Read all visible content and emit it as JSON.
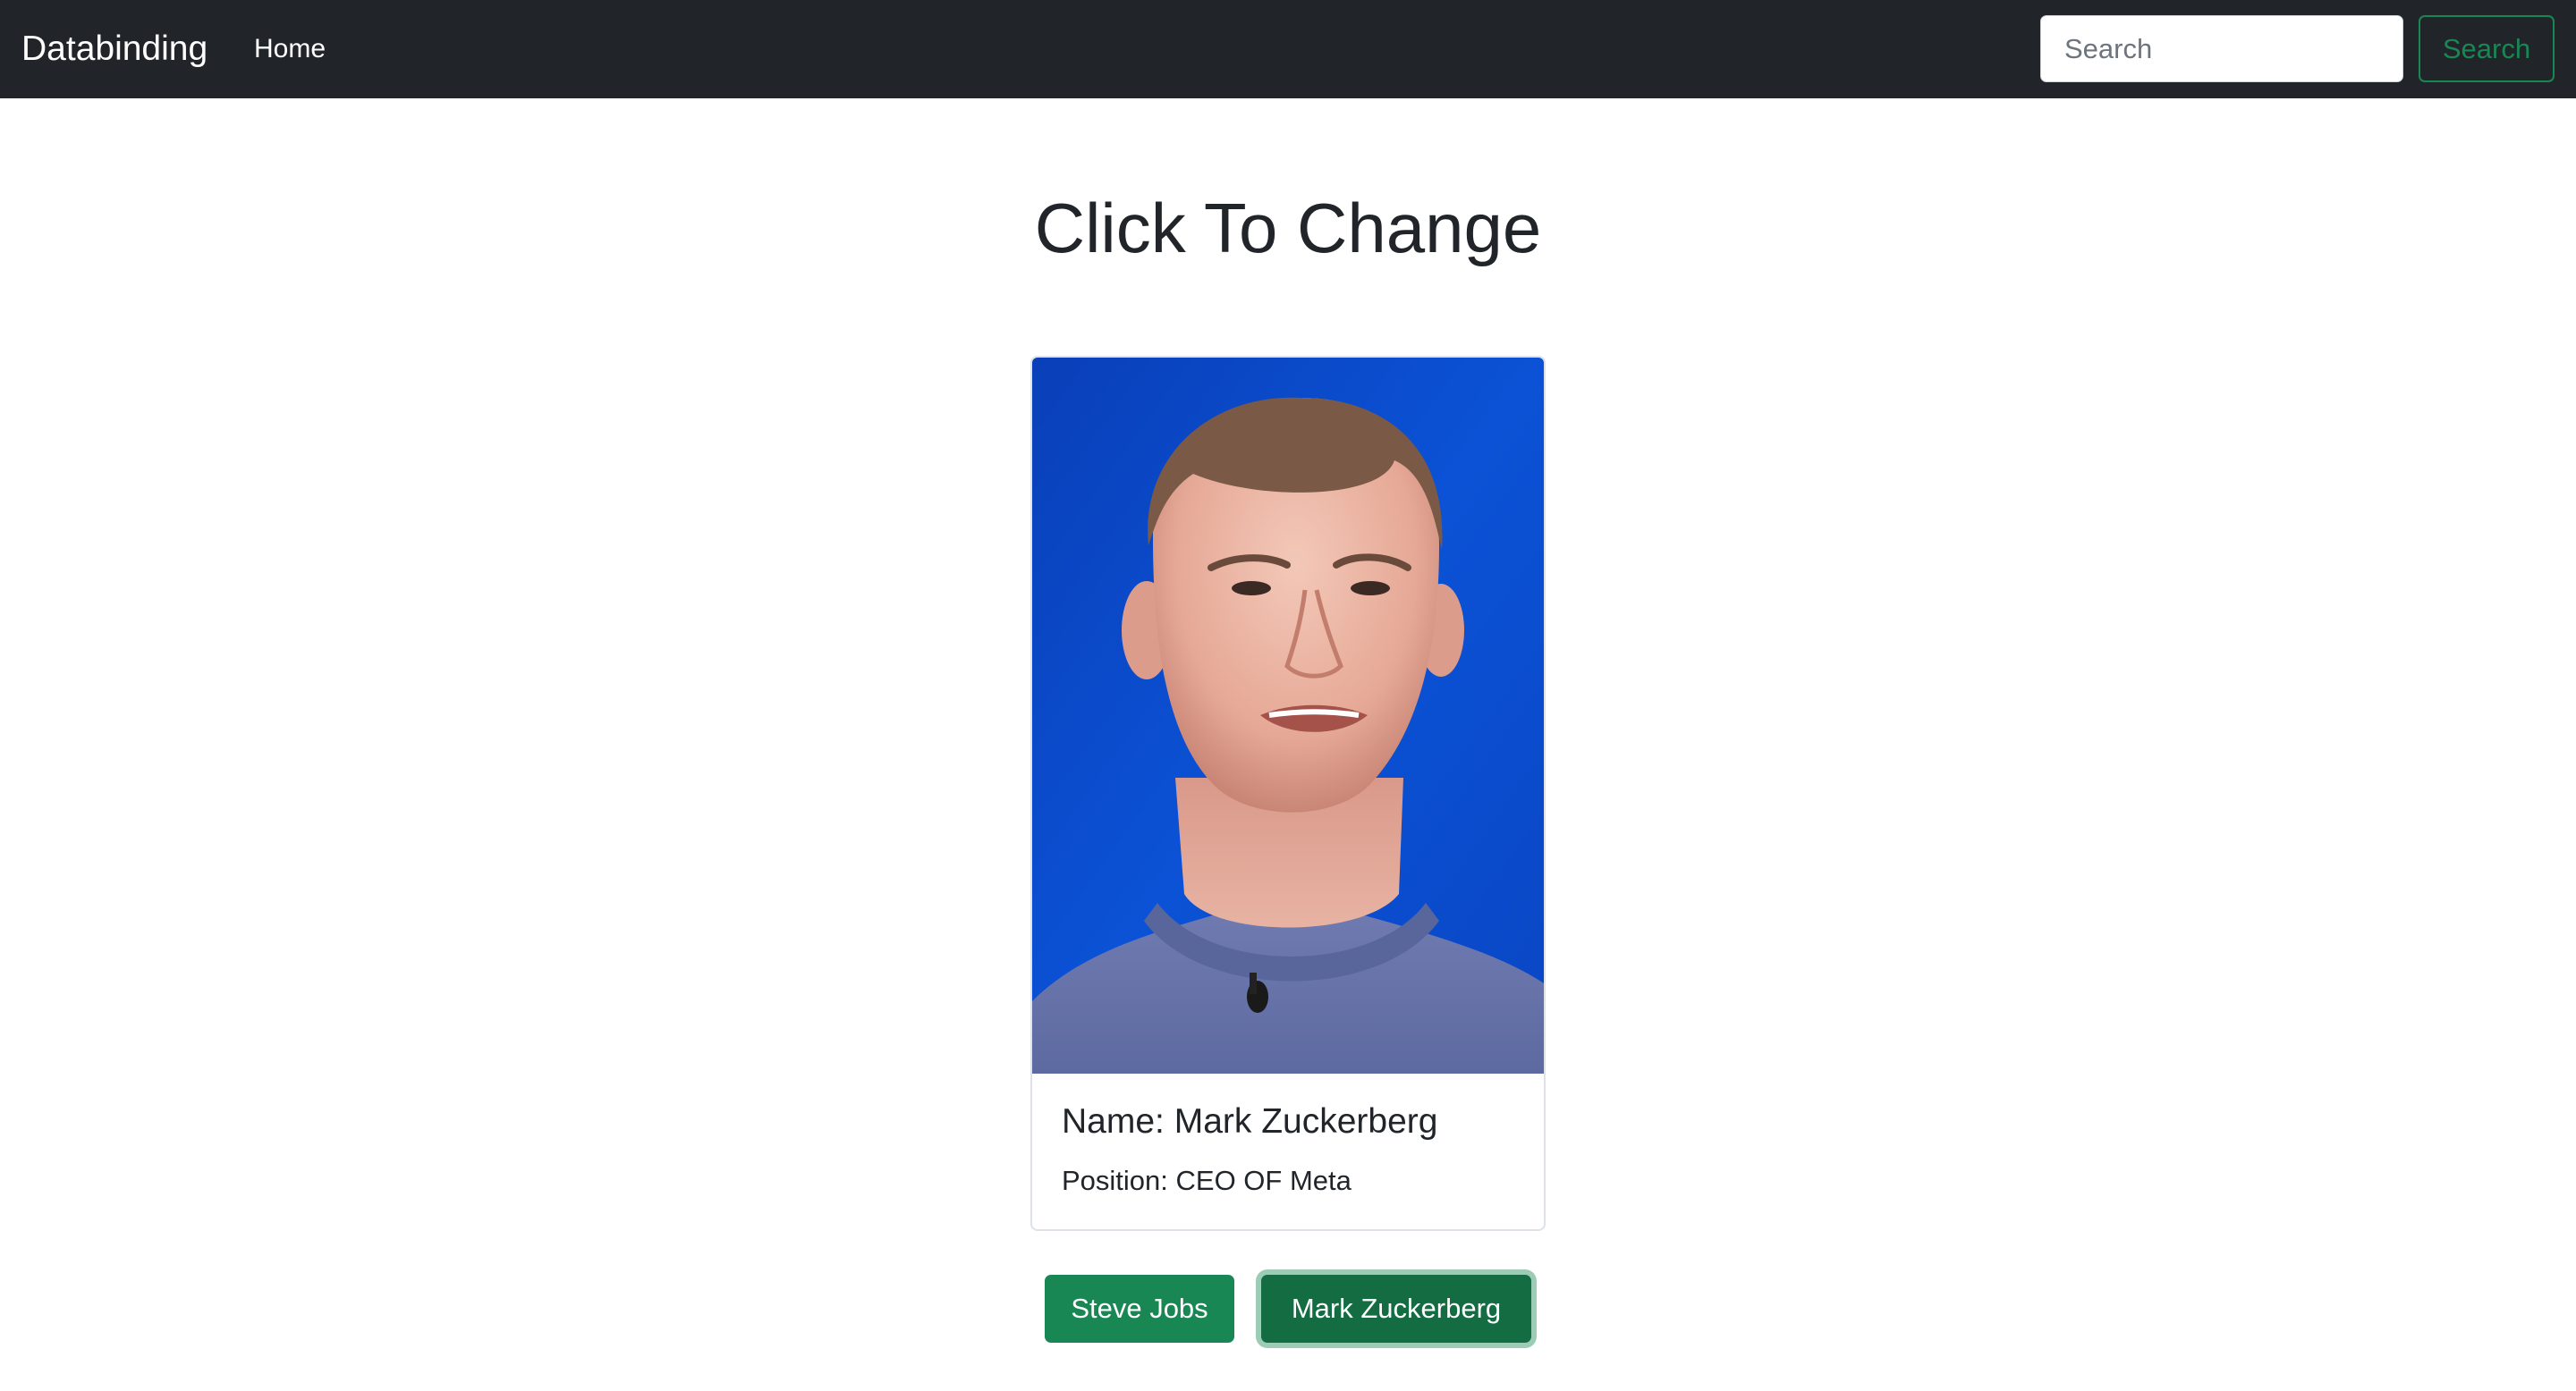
{
  "navbar": {
    "brand": "Databinding",
    "home_link": "Home",
    "search_placeholder": "Search",
    "search_button": "Search"
  },
  "page": {
    "title": "Click To Change"
  },
  "card": {
    "name_line": "Name: Mark Zuckerberg",
    "position_line": "Position: CEO OF Meta"
  },
  "buttons": {
    "steve": "Steve Jobs",
    "mark": "Mark Zuckerberg"
  },
  "colors": {
    "navbar_bg": "#212529",
    "success": "#198754",
    "success_active": "#146c43",
    "photo_bg": "#0a49c9"
  }
}
